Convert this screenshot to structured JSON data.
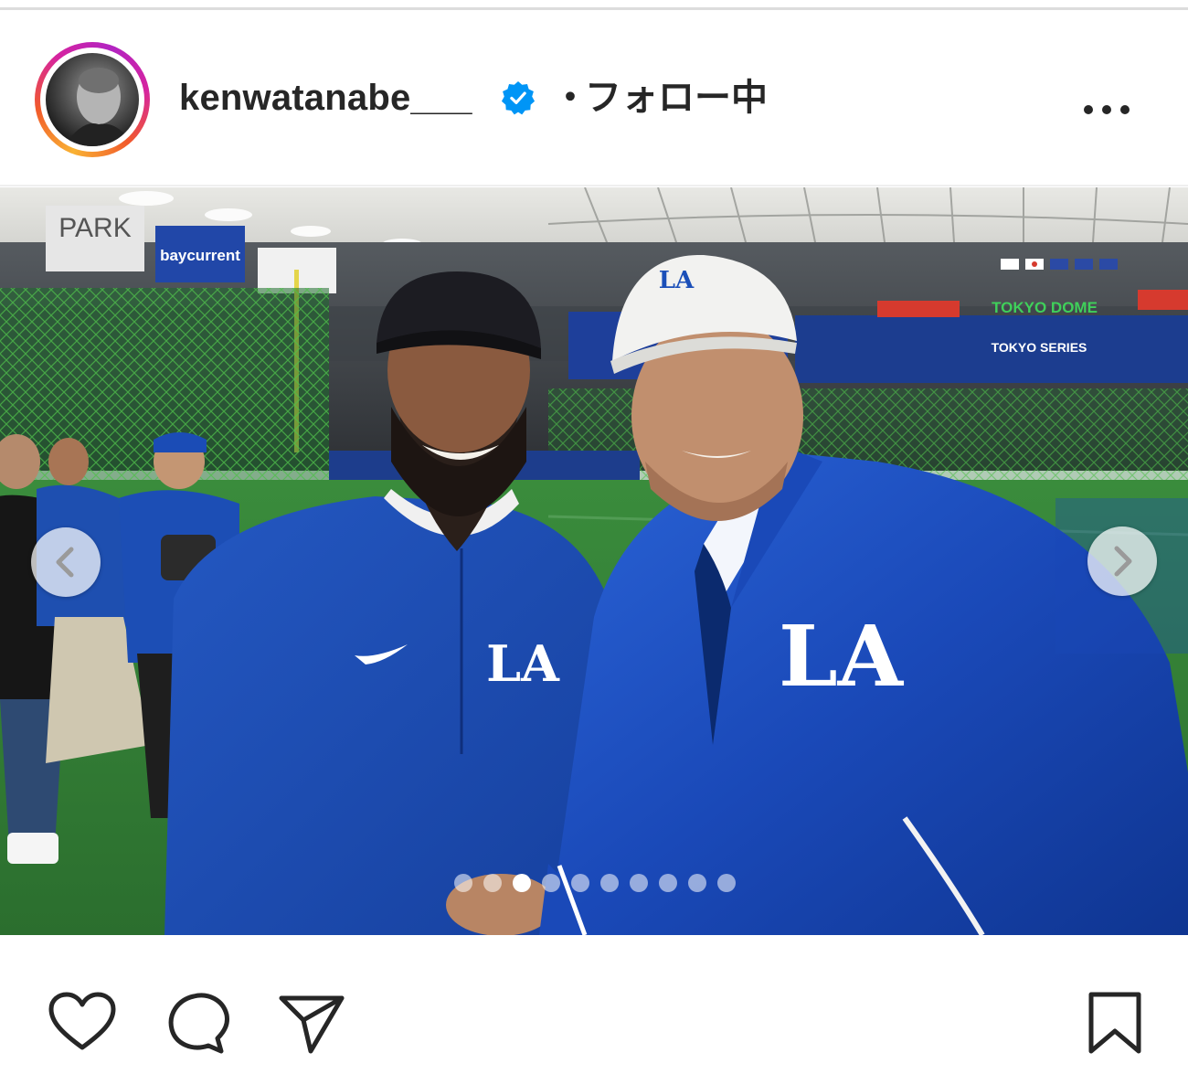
{
  "post": {
    "username": "kenwatanabe___",
    "separator": "・",
    "follow_status": "フォロー中",
    "verified": true
  },
  "carousel": {
    "slide_count": 10,
    "active_index": 2
  },
  "icons": {
    "avatar": "profile-avatar",
    "verified": "verified-badge-icon",
    "more": "more-options-icon",
    "prev": "chevron-left-icon",
    "next": "chevron-right-icon",
    "like": "heart-icon",
    "comment": "comment-icon",
    "share": "paper-plane-icon",
    "save": "bookmark-icon"
  },
  "photo_signage": {
    "park": "PARK",
    "baycurrent": "baycurrent",
    "tokyo_dome": "TOKYO DOME",
    "tokyo_series": "TOKYO SERIES",
    "la_cap": "LA",
    "la_shirt": "LA",
    "la_jacket": "LA"
  },
  "colors": {
    "dodger_blue": "#1b4fb8",
    "verified_blue": "#0095f6",
    "field_green": "#2f7a34"
  }
}
